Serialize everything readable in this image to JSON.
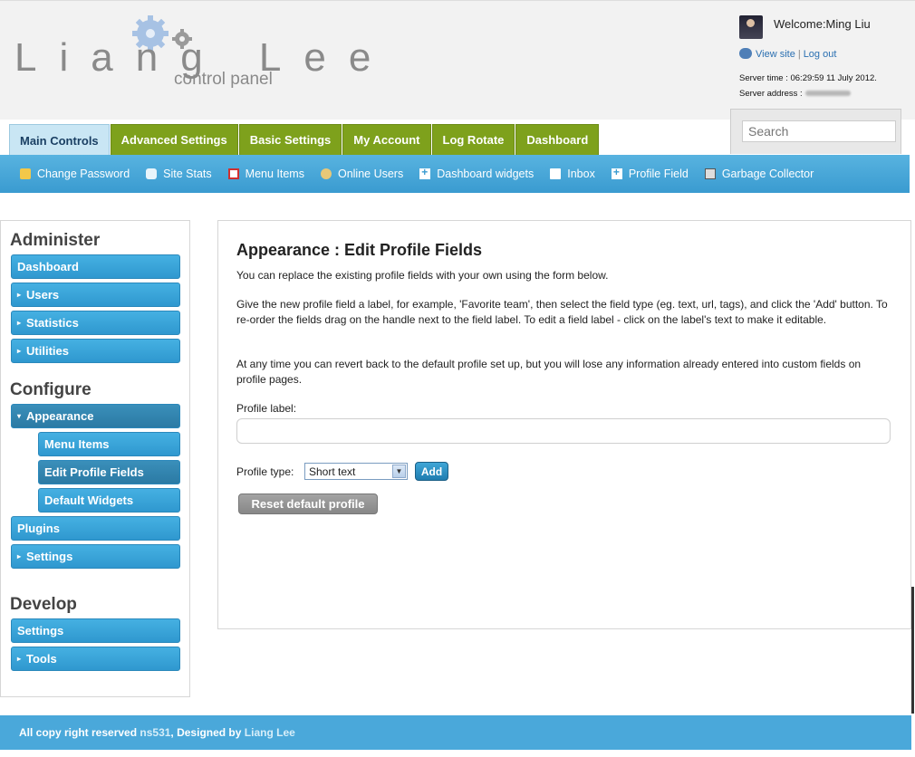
{
  "logo": {
    "title": "Liang Lee",
    "subtitle": "control panel"
  },
  "user": {
    "welcome": "Welcome:Ming Liu",
    "view_site": "View site",
    "separator": "|",
    "log_out": "Log out",
    "server_time": "Server time : 06:29:59 11 July 2012.",
    "server_address_label": "Server address :"
  },
  "tabs": [
    {
      "label": "Main Controls",
      "active": true
    },
    {
      "label": "Advanced Settings"
    },
    {
      "label": "Basic Settings"
    },
    {
      "label": "My Account"
    },
    {
      "label": "Log Rotate"
    },
    {
      "label": "Dashboard"
    }
  ],
  "search": {
    "placeholder": "Search"
  },
  "subnav": [
    {
      "label": "Change Password",
      "icon": "lock-icon"
    },
    {
      "label": "Site Stats",
      "icon": "chat-icon"
    },
    {
      "label": "Menu Items",
      "icon": "menu-icon"
    },
    {
      "label": "Online Users",
      "icon": "user-icon"
    },
    {
      "label": "Dashboard widgets",
      "icon": "plus-icon"
    },
    {
      "label": "Inbox",
      "icon": "mail-icon"
    },
    {
      "label": "Profile Field",
      "icon": "plus-icon"
    },
    {
      "label": "Garbage Collector",
      "icon": "trash-icon"
    }
  ],
  "sidebar": {
    "administer_heading": "Administer",
    "configure_heading": "Configure",
    "develop_heading": "Develop",
    "items": {
      "dashboard": "Dashboard",
      "users": "Users",
      "statistics": "Statistics",
      "utilities": "Utilities",
      "appearance": "Appearance",
      "menu_items": "Menu Items",
      "edit_profile_fields": "Edit Profile Fields",
      "default_widgets": "Default Widgets",
      "plugins": "Plugins",
      "settings": "Settings",
      "dev_settings": "Settings",
      "tools": "Tools"
    },
    "arrow": "▸",
    "arrow_open": "▾"
  },
  "main": {
    "title": "Appearance : Edit Profile Fields",
    "intro": "You can replace the existing profile fields with your own using the form below.",
    "instructions": "Give the new profile field a label, for example, 'Favorite team', then select the field type (eg. text, url, tags), and click the 'Add' button. To re-order the fields drag on the handle next to the field label. To edit a field label - click on the label's text to make it editable.",
    "revert_note": "At any time you can revert back to the default profile set up, but you will lose any information already entered into custom fields on profile pages.",
    "profile_label": "Profile label:",
    "profile_type": "Profile type:",
    "profile_type_value": "Short text",
    "add_button": "Add",
    "reset_button": "Reset default profile"
  },
  "footer": {
    "prefix": "All copy right reserved",
    "site": "ns531",
    "designed": ", Designed by",
    "author": "Liang Lee"
  },
  "colors": {
    "tab_green": "#7ea11c",
    "nav_blue": "#3a9bd0",
    "footer_blue": "#4aa8da"
  }
}
